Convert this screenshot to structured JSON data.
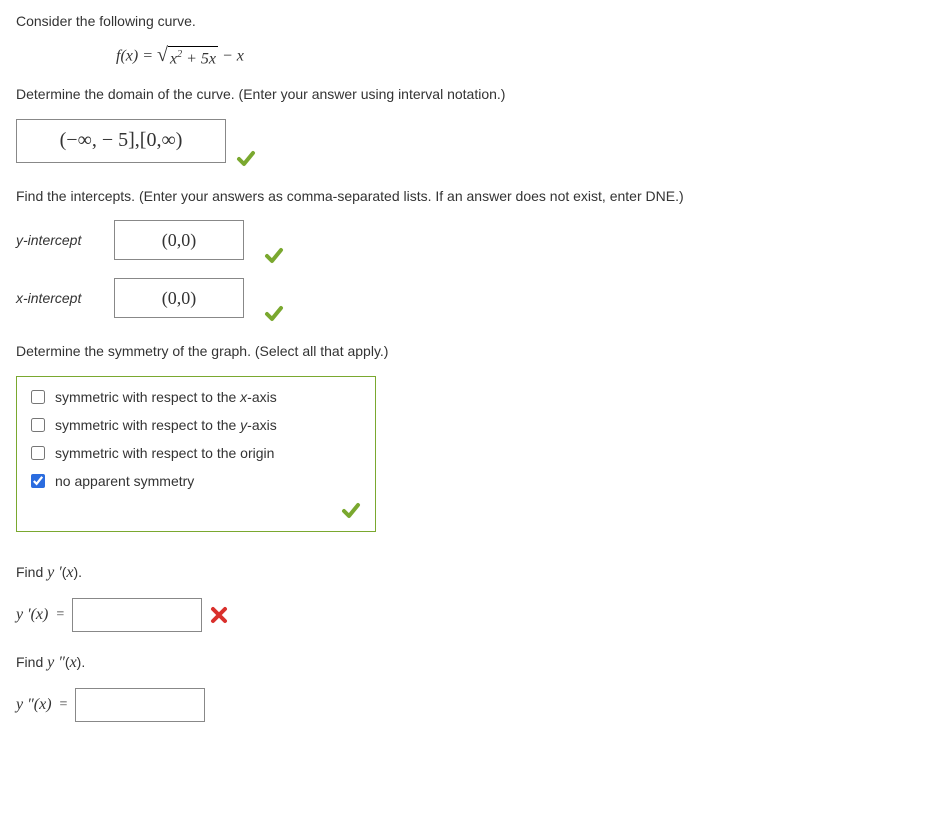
{
  "intro": "Consider the following curve.",
  "equation": {
    "lhs": "f(x) =",
    "under_sqrt": "x",
    "under_sqrt_exp": "2",
    "under_sqrt_tail": " + 5x",
    "trailing": " − x"
  },
  "domain_prompt": "Determine the domain of the curve. (Enter your answer using interval notation.)",
  "domain_answer": "(−∞, − 5],[0,∞)",
  "intercepts_prompt": "Find the intercepts. (Enter your answers as comma-separated lists. If an answer does not exist, enter DNE.)",
  "y_intercept_label": "y-intercept",
  "y_intercept_answer": "(0,0)",
  "x_intercept_label": "x-intercept",
  "x_intercept_answer": "(0,0)",
  "symmetry_prompt": "Determine the symmetry of the graph. (Select all that apply.)",
  "symmetry_options": {
    "opt1": "symmetric with respect to the x-axis",
    "opt2": "symmetric with respect to the y-axis",
    "opt3": "symmetric with respect to the origin",
    "opt4": "no apparent symmetry"
  },
  "find_yprime": "Find y ′(x).",
  "yprime_lhs": "y ′(x) =",
  "find_ydprime": "Find y ″(x).",
  "ydprime_lhs": "y ″(x) ="
}
